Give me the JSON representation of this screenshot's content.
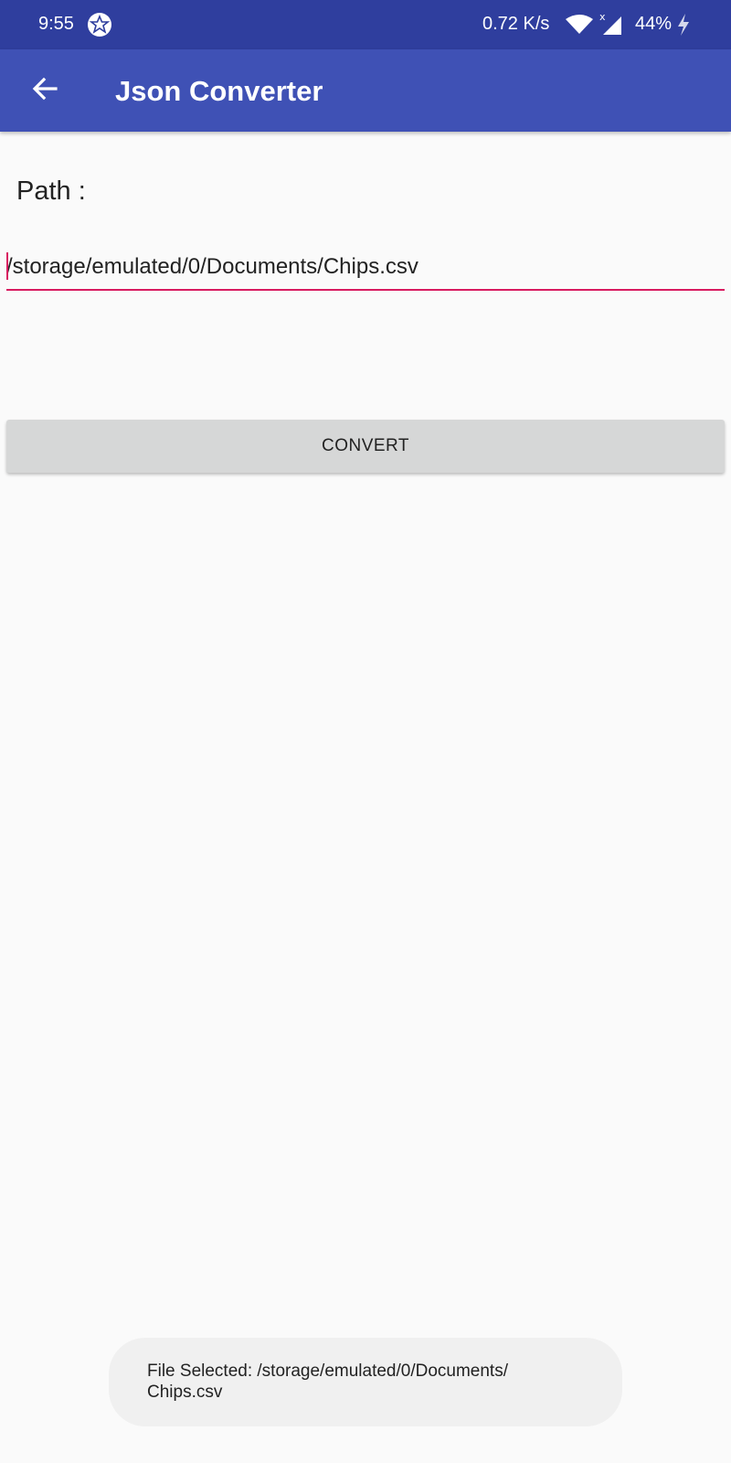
{
  "status_bar": {
    "time": "9:55",
    "network_speed": "0.72 K/s",
    "battery": "44%",
    "icons": [
      "app-notification-icon",
      "wifi-icon",
      "cell-signal-icon",
      "charging-icon"
    ]
  },
  "app_bar": {
    "title": "Json Converter",
    "back_icon": "arrow-left-icon",
    "color": "#3f51b5"
  },
  "form": {
    "path_label": "Path :",
    "path_value": "/storage/emulated/0/Documents/Chips.csv",
    "accent_color": "#d81b60"
  },
  "actions": {
    "convert_label": "CONVERT"
  },
  "toast": {
    "message": "File Selected: /storage/emulated/0/Documents/\nChips.csv"
  }
}
